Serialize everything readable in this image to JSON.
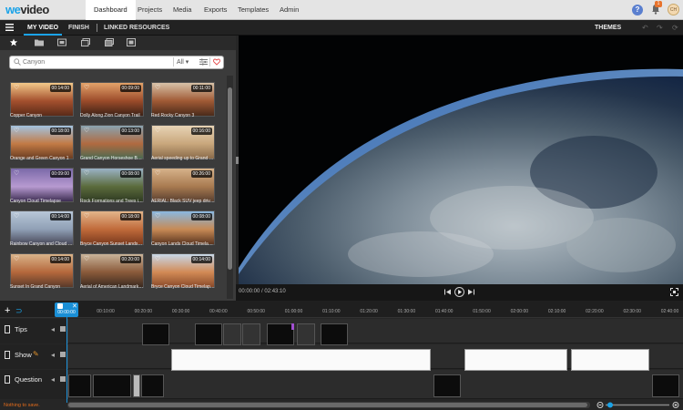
{
  "app": {
    "logo_part1": "we",
    "logo_part2": "video"
  },
  "nav": {
    "tabs": [
      "Dashboard",
      "Projects",
      "Media",
      "Exports",
      "Templates",
      "Admin"
    ],
    "active": "Dashboard"
  },
  "notifications": {
    "count": "1"
  },
  "user": {
    "initials": "CH"
  },
  "editor_tabs": {
    "my_video": "MY VIDEO",
    "finish": "FINISH",
    "linked": "LINKED RESOURCES",
    "themes": "THEMES"
  },
  "search": {
    "placeholder": "Canyon",
    "filter": "All"
  },
  "media": [
    {
      "title": "Copper Canyon",
      "duration": "00:14:00",
      "colors": [
        "#f3c98a",
        "#a4502e",
        "#5a2a18"
      ]
    },
    {
      "title": "Dolly Along Zion Canyon Trail",
      "duration": "00:09:00",
      "colors": [
        "#e3a36a",
        "#9b4b2a",
        "#3b2116"
      ]
    },
    {
      "title": "Red Rocky Canyon 3",
      "duration": "00:11:00",
      "colors": [
        "#d7c2a8",
        "#a05a35",
        "#4a2a1a"
      ]
    },
    {
      "title": "Orange and Green Canyon 1",
      "duration": "00:18:00",
      "colors": [
        "#a3c3e0",
        "#c27a45",
        "#6a3d22"
      ]
    },
    {
      "title": "Grand Canyon Horseshoe Ben...",
      "duration": "00:13:00",
      "colors": [
        "#8aa3b0",
        "#b06a40",
        "#4c6a52"
      ]
    },
    {
      "title": "Aerial speeding up to Grand Ca...",
      "duration": "00:16:00",
      "colors": [
        "#e7d3b5",
        "#c9a77c",
        "#8a6b4a"
      ]
    },
    {
      "title": "Canyon Cloud Timelapse",
      "duration": "00:09:00",
      "colors": [
        "#7b6aa9",
        "#b79ad0",
        "#3d2d52"
      ]
    },
    {
      "title": "Rock Formations and Trees in ...",
      "duration": "00:08:00",
      "colors": [
        "#9ab2c5",
        "#5b6b3c",
        "#2f3a22"
      ]
    },
    {
      "title": "AERIAL: Black SUV jeep drivin...",
      "duration": "00:26:00",
      "colors": [
        "#d6b28a",
        "#a87a50",
        "#5a4030"
      ]
    },
    {
      "title": "Rainbow Canyon and Cloud Ti...",
      "duration": "00:14:00",
      "colors": [
        "#b8c7d8",
        "#8f9fb5",
        "#4a4a5a"
      ]
    },
    {
      "title": "Bryce Canyon Sunset Landscape",
      "duration": "00:18:00",
      "colors": [
        "#e2b58a",
        "#c06a3a",
        "#7a3a1e"
      ]
    },
    {
      "title": "Canyon Lands Cloud Timelapse",
      "duration": "00:08:00",
      "colors": [
        "#8ab8e0",
        "#c78a55",
        "#5a3520"
      ]
    },
    {
      "title": "Sunset In Grand Canyon",
      "duration": "00:14:00",
      "colors": [
        "#d9b38a",
        "#b5683c",
        "#5a3a2a"
      ]
    },
    {
      "title": "Aerial of American Landmark -...",
      "duration": "00:20:00",
      "colors": [
        "#c9b49a",
        "#8a5a3a",
        "#3a2a20"
      ]
    },
    {
      "title": "Bryce Canyon Cloud Timelapse",
      "duration": "00:14:00",
      "colors": [
        "#c8d8e8",
        "#d28a55",
        "#8a4a2a"
      ]
    }
  ],
  "player": {
    "timecode": "00:00:00 / 02:43:10"
  },
  "timeline": {
    "playhead": "00:00:00",
    "ticks": [
      "00:10:00",
      "00:20:00",
      "00:30:00",
      "00:40:00",
      "00:50:00",
      "01:00:00",
      "01:10:00",
      "01:20:00",
      "01:30:00",
      "01:40:00",
      "01:50:00",
      "02:00:00",
      "02:10:00",
      "02:20:00",
      "02:30:00",
      "02:40:00"
    ],
    "tracks": [
      {
        "name": "Tips"
      },
      {
        "name": "Show"
      },
      {
        "name": "Question"
      }
    ]
  },
  "status": {
    "text": "Nothing to save."
  },
  "colors": {
    "accent": "#1aa3e8",
    "status": "#e36c1b"
  }
}
